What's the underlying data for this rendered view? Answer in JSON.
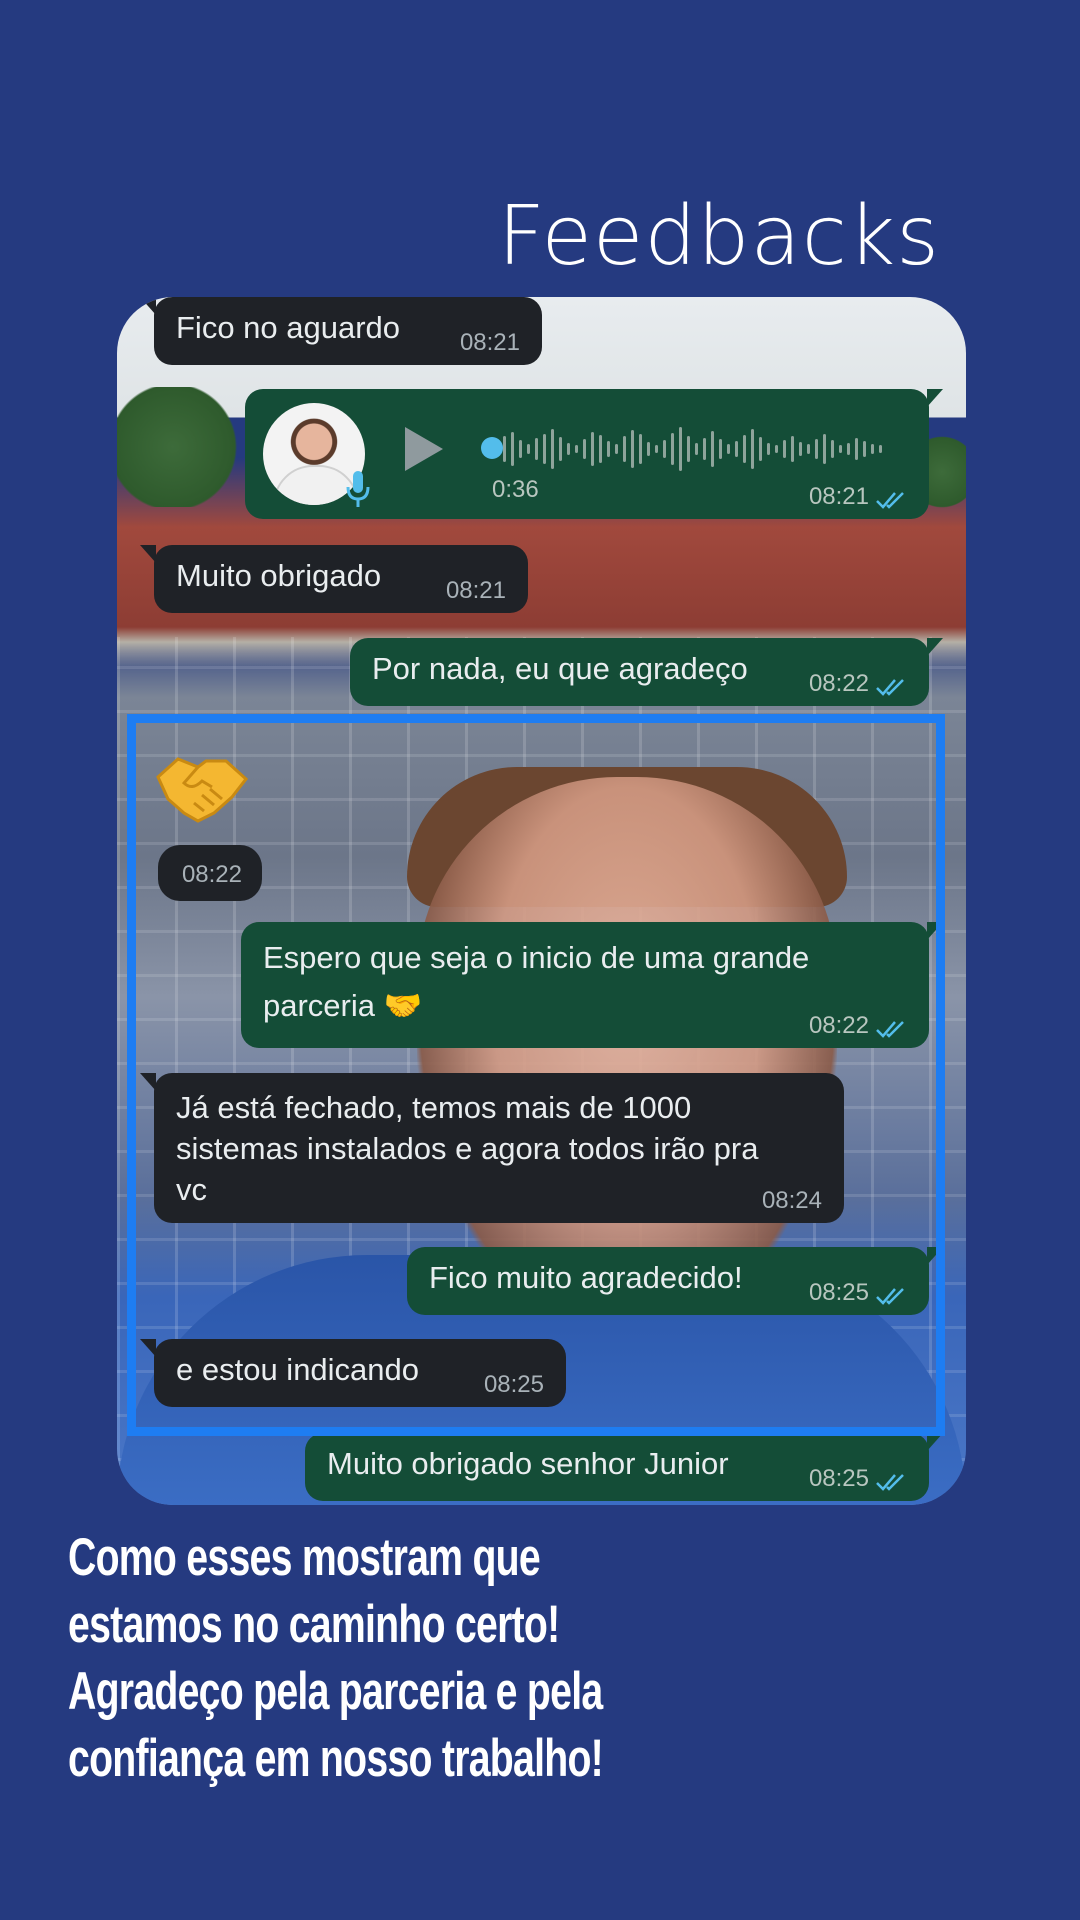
{
  "page": {
    "title": "Feedbacks",
    "caption": "Como esses mostram que\nestamos no caminho certo!\nAgradeço pela parceria e pela\nconfiança em nosso trabalho!"
  },
  "colors": {
    "background": "#253a80",
    "incoming_bubble": "#1f2227",
    "outgoing_bubble": "#144d37",
    "read_ticks": "#53bdeb",
    "highlight_frame": "#1e7df2"
  },
  "messages": [
    {
      "direction": "in",
      "text": "Fico no aguardo",
      "time": "08:21"
    },
    {
      "direction": "out",
      "type": "audio",
      "duration": "0:36",
      "time": "08:21",
      "status": "read"
    },
    {
      "direction": "in",
      "text": "Muito obrigado",
      "time": "08:21"
    },
    {
      "direction": "out",
      "text": "Por nada, eu que agradeço",
      "time": "08:22",
      "status": "read"
    },
    {
      "direction": "in",
      "type": "emoji",
      "emoji": "handshake-icon",
      "time": "08:22"
    },
    {
      "direction": "out",
      "text": "Espero que seja o inicio de uma grande parceria 🤝",
      "time": "08:22",
      "status": "read"
    },
    {
      "direction": "in",
      "text": "Já está fechado, temos mais de 1000 sistemas instalados e agora todos irão pra vc",
      "time": "08:24"
    },
    {
      "direction": "out",
      "text": "Fico muito agradecido!",
      "time": "08:25",
      "status": "read"
    },
    {
      "direction": "in",
      "text": "e estou indicando",
      "time": "08:25"
    },
    {
      "direction": "out",
      "text": "Muito obrigado senhor Junior",
      "time": "08:25",
      "status": "read"
    }
  ]
}
